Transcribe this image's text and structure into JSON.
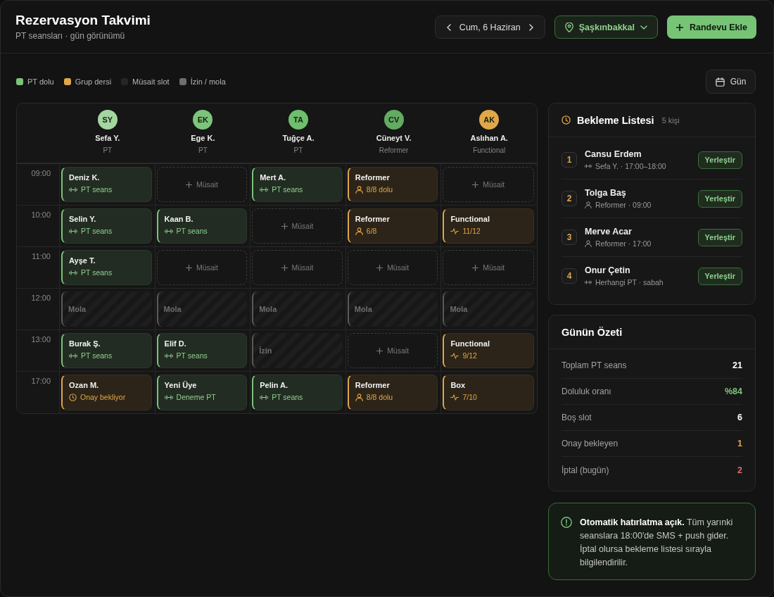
{
  "header": {
    "title": "Rezervasyon Takvimi",
    "subtitle": "PT seansları · gün görünümü",
    "date": "Cum, 6 Haziran",
    "location": "Şaşkınbakkal",
    "add_button": "Randevu Ekle"
  },
  "legend": [
    {
      "label": "PT dolu",
      "color": "#7cc47c"
    },
    {
      "label": "Grup dersi",
      "color": "#e0a64a"
    },
    {
      "label": "Müsait slot",
      "color": "#262626"
    },
    {
      "label": "İzin / mola",
      "color": "#6e6e6e"
    }
  ],
  "view_button": "Gün",
  "calendar": {
    "trainers": [
      {
        "initials": "SY",
        "name": "Sefa Y.",
        "role": "PT",
        "color": "#a3d6a0"
      },
      {
        "initials": "EK",
        "name": "Ege K.",
        "role": "PT",
        "color": "#7cc47c"
      },
      {
        "initials": "TA",
        "name": "Tuğçe A.",
        "role": "PT",
        "color": "#6dbf6d"
      },
      {
        "initials": "CV",
        "name": "Cüneyt V.",
        "role": "Reformer",
        "color": "#62ab62"
      },
      {
        "initials": "AK",
        "name": "Aslıhan A.",
        "role": "Functional",
        "color": "#e0a64a"
      }
    ],
    "rows": [
      {
        "time": "09:00",
        "cells": [
          {
            "kind": "pt",
            "title": "Deniz K.",
            "detail": "PT seans"
          },
          {
            "kind": "free",
            "label": "Müsait"
          },
          {
            "kind": "pt",
            "title": "Mert A.",
            "detail": "PT seans"
          },
          {
            "kind": "group",
            "title": "Reformer",
            "detail": "8/8 dolu"
          },
          {
            "kind": "free",
            "label": "Müsait"
          }
        ]
      },
      {
        "time": "10:00",
        "cells": [
          {
            "kind": "pt",
            "title": "Selin Y.",
            "detail": "PT seans"
          },
          {
            "kind": "pt",
            "title": "Kaan B.",
            "detail": "PT seans"
          },
          {
            "kind": "free",
            "label": "Müsait"
          },
          {
            "kind": "group",
            "title": "Reformer",
            "detail": "6/8"
          },
          {
            "kind": "circuit",
            "title": "Functional",
            "detail": "11/12"
          }
        ]
      },
      {
        "time": "11:00",
        "cells": [
          {
            "kind": "pt",
            "title": "Ayşe T.",
            "detail": "PT seans"
          },
          {
            "kind": "free",
            "label": "Müsait"
          },
          {
            "kind": "free",
            "label": "Müsait"
          },
          {
            "kind": "free",
            "label": "Müsait"
          },
          {
            "kind": "free",
            "label": "Müsait"
          }
        ]
      },
      {
        "time": "12:00",
        "cells": [
          {
            "kind": "break",
            "label": "Mola"
          },
          {
            "kind": "break",
            "label": "Mola"
          },
          {
            "kind": "break",
            "label": "Mola"
          },
          {
            "kind": "break",
            "label": "Mola"
          },
          {
            "kind": "break",
            "label": "Mola"
          }
        ]
      },
      {
        "time": "13:00",
        "cells": [
          {
            "kind": "pt",
            "title": "Burak Ş.",
            "detail": "PT seans"
          },
          {
            "kind": "pt",
            "title": "Elif D.",
            "detail": "PT seans"
          },
          {
            "kind": "break",
            "label": "İzin"
          },
          {
            "kind": "free",
            "label": "Müsait"
          },
          {
            "kind": "circuit",
            "title": "Functional",
            "detail": "9/12"
          }
        ]
      },
      {
        "time": "17:00",
        "cells": [
          {
            "kind": "pending",
            "title": "Ozan M.",
            "detail": "Onay bekliyor"
          },
          {
            "kind": "pt",
            "title": "Yeni Üye",
            "detail": "Deneme PT"
          },
          {
            "kind": "pt",
            "title": "Pelin A.",
            "detail": "PT seans"
          },
          {
            "kind": "group",
            "title": "Reformer",
            "detail": "8/8 dolu"
          },
          {
            "kind": "circuit",
            "title": "Box",
            "detail": "7/10"
          }
        ]
      }
    ]
  },
  "waitlist": {
    "title": "Bekleme Listesi",
    "count": "5 kişi",
    "items": [
      {
        "number": "1",
        "name": "Cansu Erdem",
        "kind": "pt",
        "detail": "Sefa Y. · 17:00–18:00",
        "button": "Yerleştir"
      },
      {
        "number": "2",
        "name": "Tolga Baş",
        "kind": "group",
        "detail": "Reformer · 09:00",
        "button": "Yerleştir"
      },
      {
        "number": "3",
        "name": "Merve Acar",
        "kind": "group",
        "detail": "Reformer · 17:00",
        "button": "Yerleştir"
      },
      {
        "number": "4",
        "name": "Onur Çetin",
        "kind": "pt",
        "detail": "Herhangi PT · sabah",
        "button": "Yerleştir"
      }
    ]
  },
  "summary": {
    "title": "Günün Özeti",
    "rows": [
      {
        "label": "Toplam PT seans",
        "value": "21",
        "color": "#ffffff"
      },
      {
        "label": "Doluluk oranı",
        "value": "%84",
        "color": "#7cc47c"
      },
      {
        "label": "Boş slot",
        "value": "6",
        "color": "#ffffff"
      },
      {
        "label": "Onay bekleyen",
        "value": "1",
        "color": "#e0a64a"
      },
      {
        "label": "İptal (bugün)",
        "value": "2",
        "color": "#e06c6c"
      }
    ]
  },
  "note": {
    "text": "**Otomatik hatırlatma açık.** Tüm yarınki seanslara 18:00'de SMS + push gider. İptal olursa bekleme listesi sırayla bilgilendirilir."
  }
}
